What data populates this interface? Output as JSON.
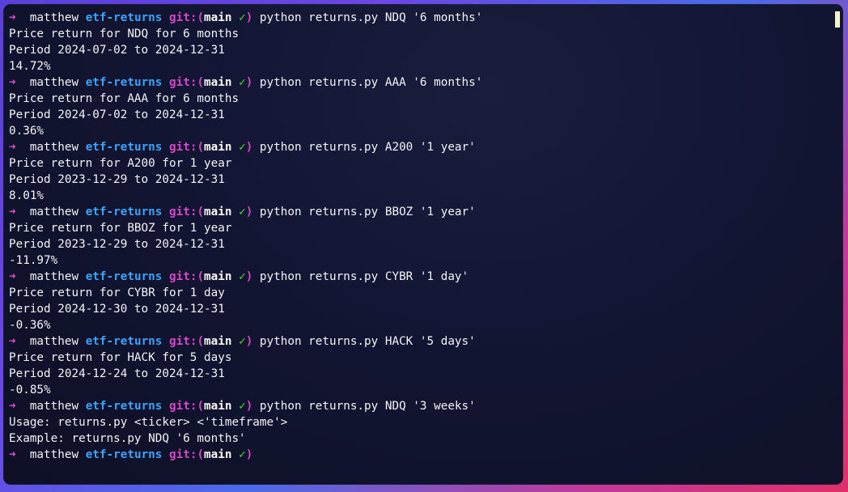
{
  "prompt": {
    "arrow": "➜",
    "user": "matthew",
    "dir": "etf-returns",
    "git_label": "git:",
    "branch": "main",
    "check": "✓"
  },
  "blocks": [
    {
      "command": "python returns.py NDQ '6 months'",
      "output": [
        "Price return for NDQ for 6 months",
        "Period 2024-07-02 to 2024-12-31",
        "14.72%"
      ]
    },
    {
      "command": "python returns.py AAA '6 months'",
      "output": [
        "Price return for AAA for 6 months",
        "Period 2024-07-02 to 2024-12-31",
        "0.36%"
      ]
    },
    {
      "command": "python returns.py A200 '1 year'",
      "output": [
        "Price return for A200 for 1 year",
        "Period 2023-12-29 to 2024-12-31",
        "8.01%"
      ]
    },
    {
      "command": "python returns.py BBOZ '1 year'",
      "output": [
        "Price return for BBOZ for 1 year",
        "Period 2023-12-29 to 2024-12-31",
        "-11.97%"
      ]
    },
    {
      "command": "python returns.py CYBR '1 day'",
      "output": [
        "Price return for CYBR for 1 day",
        "Period 2024-12-30 to 2024-12-31",
        "-0.36%"
      ]
    },
    {
      "command": "python returns.py HACK '5 days'",
      "output": [
        "Price return for HACK for 5 days",
        "Period 2024-12-24 to 2024-12-31",
        "-0.85%"
      ]
    },
    {
      "command": "python returns.py NDQ '3 weeks'",
      "output": [
        "Usage: returns.py <ticker> <'timeframe'>",
        "Example: returns.py NDQ '6 months'"
      ]
    },
    {
      "command": "",
      "output": []
    }
  ],
  "colors": {
    "arrow": "#e34bd0",
    "dir": "#3ea2ff",
    "git": "#d447c6",
    "check": "#4cd52a",
    "text": "#f3f3f7",
    "cursor": "#f7f3c8"
  }
}
